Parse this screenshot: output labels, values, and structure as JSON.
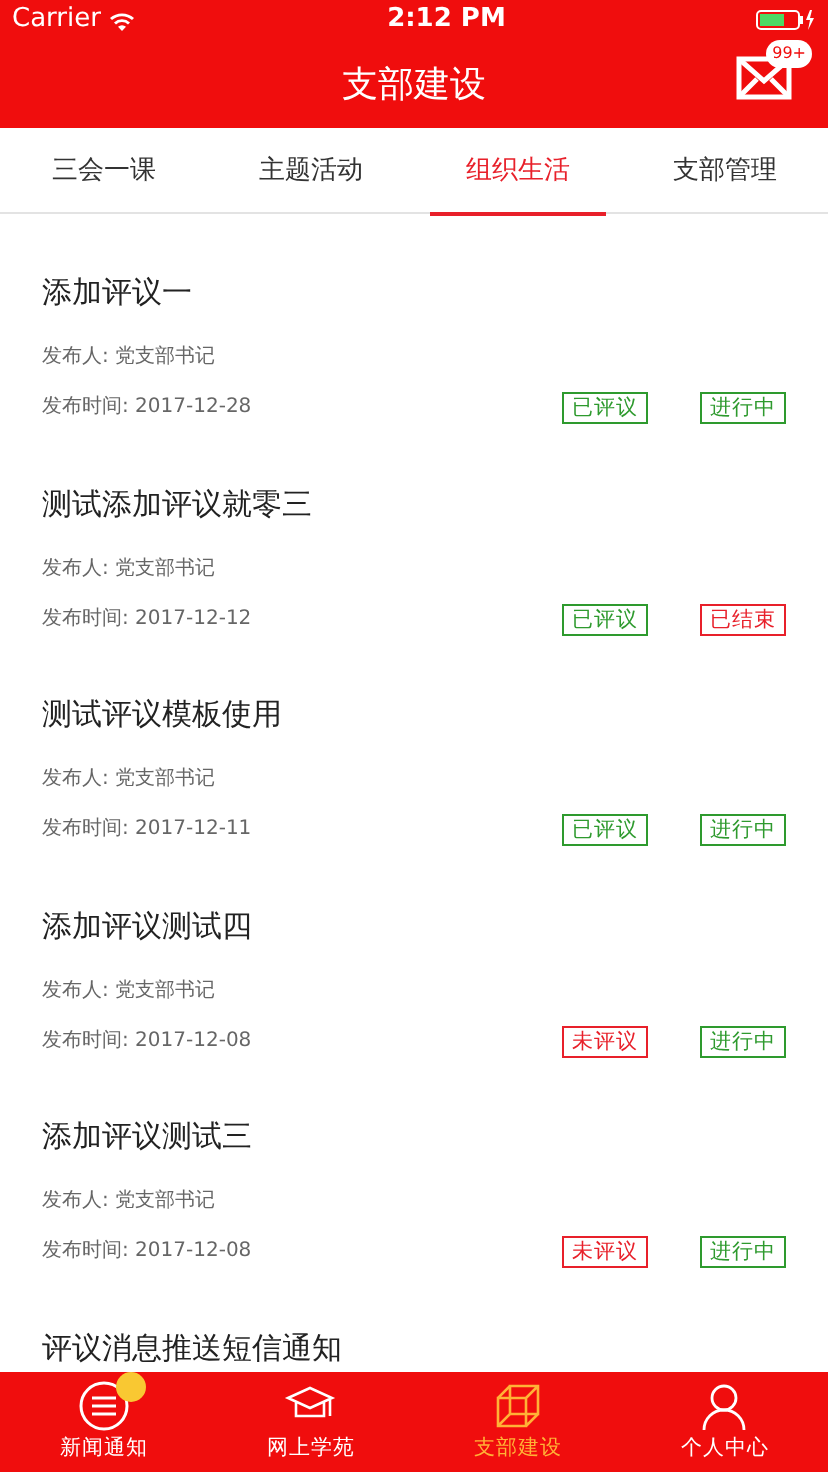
{
  "status_bar": {
    "carrier": "Carrier",
    "time": "2:12 PM"
  },
  "header": {
    "title": "支部建设",
    "badge": "99+"
  },
  "tabs": [
    {
      "label": "三会一课",
      "selected": false
    },
    {
      "label": "主题活动",
      "selected": false
    },
    {
      "label": "组织生活",
      "selected": true
    },
    {
      "label": "支部管理",
      "selected": false
    }
  ],
  "items": [
    {
      "title": "添加评议一",
      "publisher": "发布人: 党支部书记",
      "date": "发布时间: 2017-12-28",
      "tags": [
        {
          "label": "已评议",
          "color": "#2e9a2e"
        },
        {
          "label": "进行中",
          "color": "#2e9a2e"
        }
      ]
    },
    {
      "title": "测试添加评议就零三",
      "publisher": "发布人: 党支部书记",
      "date": "发布时间: 2017-12-12",
      "tags": [
        {
          "label": "已评议",
          "color": "#2e9a2e"
        },
        {
          "label": "已结束",
          "color": "#e8202a"
        }
      ]
    },
    {
      "title": "测试评议模板使用",
      "publisher": "发布人: 党支部书记",
      "date": "发布时间: 2017-12-11",
      "tags": [
        {
          "label": "已评议",
          "color": "#2e9a2e"
        },
        {
          "label": "进行中",
          "color": "#2e9a2e"
        }
      ]
    },
    {
      "title": "添加评议测试四",
      "publisher": "发布人: 党支部书记",
      "date": "发布时间: 2017-12-08",
      "tags": [
        {
          "label": "未评议",
          "color": "#e8202a"
        },
        {
          "label": "进行中",
          "color": "#2e9a2e"
        }
      ]
    },
    {
      "title": "添加评议测试三",
      "publisher": "发布人: 党支部书记",
      "date": "发布时间: 2017-12-08",
      "tags": [
        {
          "label": "未评议",
          "color": "#e8202a"
        },
        {
          "label": "进行中",
          "color": "#2e9a2e"
        }
      ]
    },
    {
      "title": "评议消息推送短信通知"
    }
  ],
  "tab_bar": [
    {
      "label": "新闻通知",
      "kind": "news",
      "selected": false,
      "dot": true
    },
    {
      "label": "网上学苑",
      "kind": "study",
      "selected": false,
      "dot": false
    },
    {
      "label": "支部建设",
      "kind": "branch",
      "selected": true,
      "dot": false
    },
    {
      "label": "个人中心",
      "kind": "person",
      "selected": false,
      "dot": false
    }
  ]
}
